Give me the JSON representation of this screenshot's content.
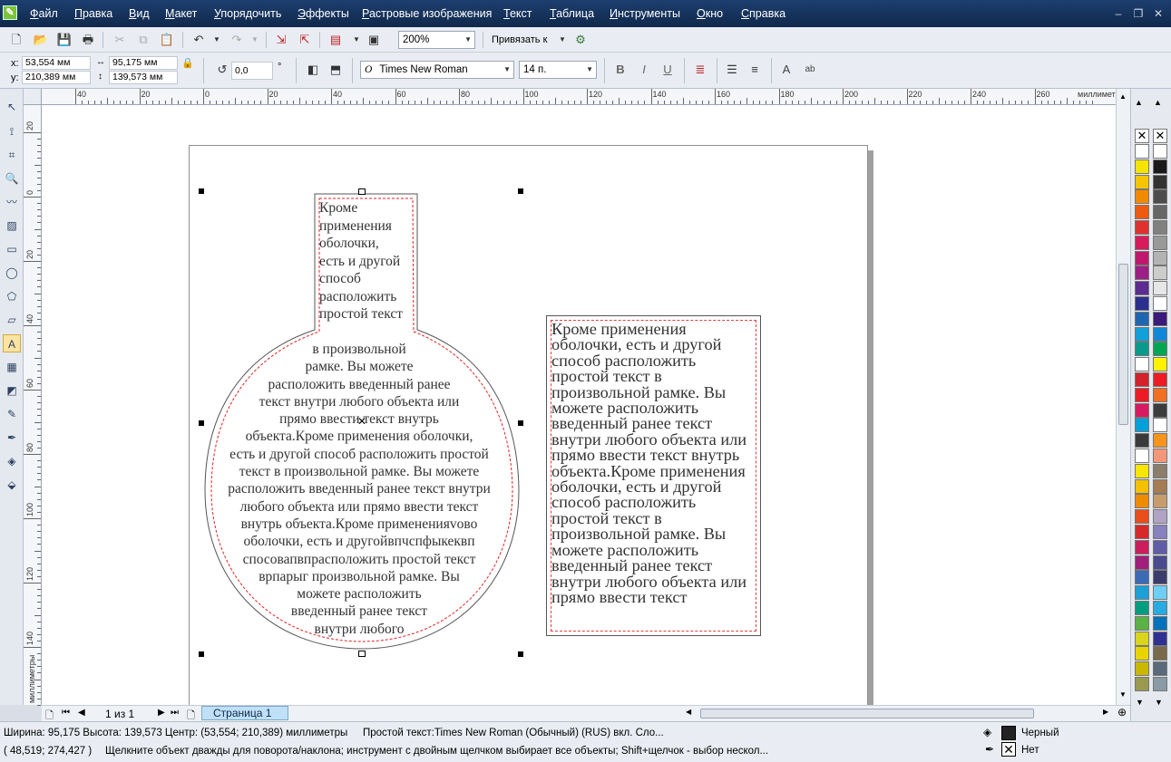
{
  "menu": [
    "Файл",
    "Правка",
    "Вид",
    "Макет",
    "Упорядочить",
    "Эффекты",
    "Растровые изображения",
    "Текст",
    "Таблица",
    "Инструменты",
    "Окно",
    "Справка"
  ],
  "toolbar": {
    "zoom": "200%",
    "snap_label": "Привязать к"
  },
  "properties": {
    "x_label": "x:",
    "x_value": "53,554 мм",
    "y_label": "y:",
    "y_value": "210,389 мм",
    "width_value": "95,175 мм",
    "height_value": "139,573 мм",
    "rotation": "0,0",
    "degree": "°",
    "font_name": "Times New Roman",
    "font_size": "14 п.",
    "bold": "B",
    "italic": "I",
    "underline": "U",
    "font_glyph": "O",
    "extra1": "A",
    "extra2": "ab"
  },
  "ruler": {
    "unit": "миллиметры",
    "h_labels": [
      "40",
      "20",
      "0",
      "20",
      "40",
      "60",
      "80",
      "100",
      "120",
      "140",
      "160",
      "180",
      "200",
      "220",
      "240",
      "260"
    ],
    "v_labels": [
      "20",
      "0",
      "20",
      "40",
      "60",
      "80",
      "100",
      "120",
      "140"
    ]
  },
  "envelope_text": {
    "top": [
      "Кроме",
      "применения",
      "оболочки,",
      "есть и другой",
      "способ",
      "расположить",
      "простой текст"
    ],
    "bottom": [
      "в произвольной",
      "рамке. Вы можете",
      "расположить введенный ранее",
      "текст внутри любого объекта или",
      "прямо ввести текст внутрь",
      "объекта.Кроме применения оболочки,",
      "есть и другой способ расположить простой",
      "текст в произвольной рамке. Вы можете",
      "расположить введенный ранее текст внутри",
      "любого объекта или прямо ввести текст",
      "внутрь объекта.Кроме примененияvовo",
      "оболочки, есть и другойвпчспфыкеквп",
      "спосовапвпрасположить простой текст",
      "врпарыг произвольной рамке. Вы",
      "можете расположить",
      "введенный ранее текст",
      "внутри любого"
    ]
  },
  "frame_text": "Кроме применения оболочки, есть и другой способ расположить простой текст в произвольной рамке. Вы можете расположить введенный ранее текст внутри любого объекта или прямо ввести текст внутрь объекта.Кроме применения оболочки, есть и другой способ расположить простой текст в произвольной рамке. Вы можете расположить введенный ранее текст внутри любого объекта или прямо ввести текст",
  "page_nav": {
    "count": "1 из 1",
    "tab": "Страница 1"
  },
  "status": {
    "line1": "Ширина: 95,175 Высота: 139,573 Центр: (53,554; 210,389)  миллиметры",
    "object_info": "Простой текст:Times New Roman (Обычный) (RUS) вкл. Сло...",
    "fill_label": "Черный",
    "coords": "( 48,519; 274,427 )",
    "hint": "Щелкните объект дважды для поворота/наклона; инструмент с двойным щелчком выбирает все объекты; Shift+щелчок - выбор нескол...",
    "outline_label": "Нет"
  },
  "colors": {
    "menubar": "#10284b",
    "page_tab": "#bfe0f7",
    "text_color": "#333333"
  }
}
